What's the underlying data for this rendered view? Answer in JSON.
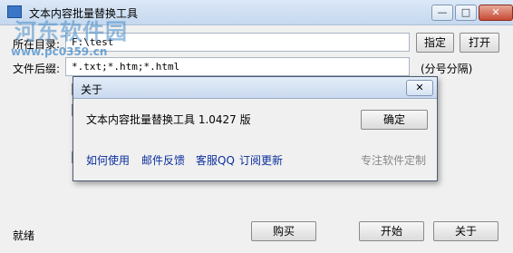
{
  "window": {
    "title": "文本内容批量替换工具",
    "min_btn": "—",
    "max_btn": "□",
    "close_btn": "✕"
  },
  "watermark": {
    "logo": "河东软件园",
    "url": "www.pc0359.cn"
  },
  "form": {
    "dir_label": "所在目录:",
    "dir_value": "F:\\test",
    "specify_btn": "指定",
    "open_btn": "打开",
    "suffix_label": "文件后缀:",
    "suffix_value": "*.txt;*.htm;*.html",
    "suffix_hint": "(分号分隔)"
  },
  "status": {
    "text": "就绪"
  },
  "bottom": {
    "buy_btn": "购买",
    "start_btn": "开始",
    "about_btn": "关于"
  },
  "about": {
    "title": "关于",
    "close_btn": "✕",
    "info": "文本内容批量替换工具 1.0427 版",
    "ok_btn": "确定",
    "links": [
      "如何使用",
      "邮件反馈",
      "客服QQ",
      "订阅更新"
    ],
    "custom": "专注软件定制"
  }
}
